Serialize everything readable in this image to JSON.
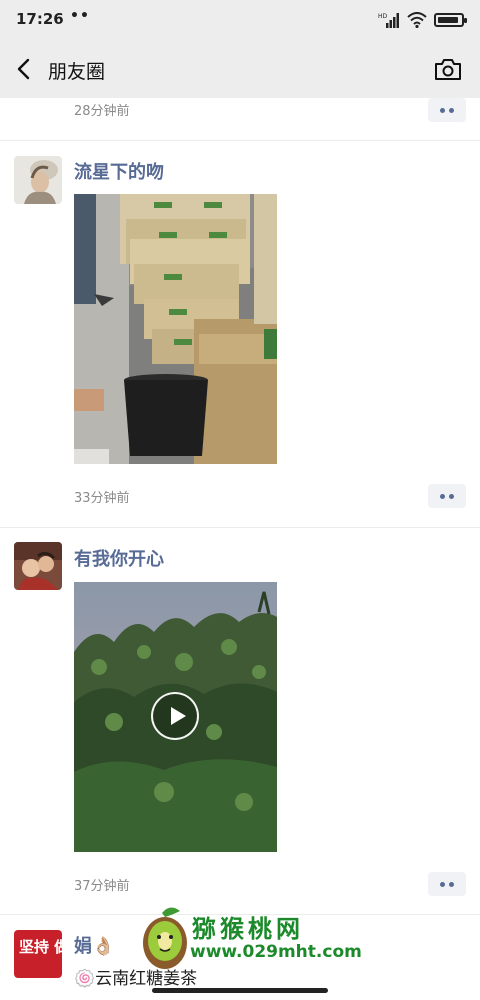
{
  "status_bar": {
    "time": "17:26",
    "dots": "••",
    "hd": "HD",
    "battery_level": 0.9
  },
  "nav": {
    "title": "朋友圈",
    "back_icon": "chevron-left-icon",
    "camera_icon": "camera-icon"
  },
  "posts": [
    {
      "time": "28分钟前"
    },
    {
      "name": "流星下的吻",
      "time": "33分钟前",
      "media": "photo"
    },
    {
      "name": "有我你开心",
      "time": "37分钟前",
      "media": "video"
    },
    {
      "name": "娟👌🏼",
      "caption": "🍥云南红糖姜茶",
      "avatar_text": "坚持 做最好的自己"
    }
  ],
  "watermark": {
    "title": "猕猴桃网",
    "url": "www.029mht.com"
  },
  "colors": {
    "name_blue": "#576b95",
    "bar_bg": "#ededed",
    "watermark_green": "#1c8a2a"
  }
}
